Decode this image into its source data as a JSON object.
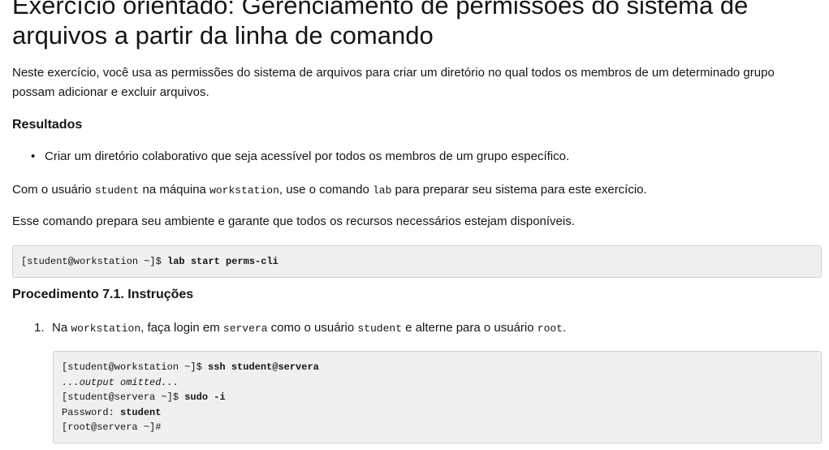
{
  "title": "Exercício orientado: Gerenciamento de permissões do sistema de arquivos a partir da linha de comando",
  "intro": "Neste exercício, você usa as permissões do sistema de arquivos para criar um diretório no qual todos os membros de um determinado grupo possam adicionar e excluir arquivos.",
  "results": {
    "heading": "Resultados",
    "items": [
      "Criar um diretório colaborativo que seja acessível por todos os membros de um grupo específico."
    ]
  },
  "para1": {
    "t1": "Com o usuário ",
    "c1": "student",
    "t2": " na máquina ",
    "c2": "workstation",
    "t3": ", use o comando ",
    "c3": "lab",
    "t4": " para preparar seu sistema para este exercício."
  },
  "para2": "Esse comando prepara seu ambiente e garante que todos os recursos necessários estejam disponíveis.",
  "code1": {
    "prompt": "[student@workstation ~]$ ",
    "command": "lab start perms-cli"
  },
  "procedure": {
    "heading": "Procedimento 7.1. Instruções",
    "step1": {
      "number": "1.",
      "t1": "Na ",
      "c1": "workstation",
      "t2": ", faça login em ",
      "c2": "servera",
      "t3": " como o usuário ",
      "c3": "student",
      "t4": " e alterne para o usuário ",
      "c4": "root",
      "t5": "."
    },
    "code": {
      "l1_prompt": "[student@workstation ~]$ ",
      "l1_cmd": "ssh student@servera",
      "l2": "...output omitted...",
      "l3_prompt": "[student@servera ~]$ ",
      "l3_cmd": "sudo -i",
      "l4_label": "Password: ",
      "l4_value": "student",
      "l5": "[root@servera ~]#"
    }
  }
}
